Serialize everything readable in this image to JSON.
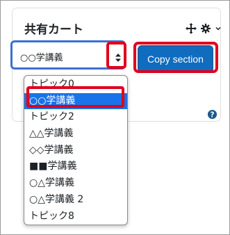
{
  "block": {
    "title": "共有カート"
  },
  "section_select": {
    "value": "○○学講義",
    "options": [
      "トピック0",
      "○○学講義",
      "トピック2",
      "△△学講義",
      "◇◇学講義",
      "■■学講義",
      "○△学講義",
      "○△学講義 2",
      "トピック8"
    ],
    "selected_index": 1
  },
  "copy_button": {
    "label": "Copy section"
  },
  "icons": {
    "move": "move-icon",
    "gear": "gear-icon",
    "chevron": "chevron-down-icon",
    "help": "help-icon",
    "select_arrows": "select-arrows-icon"
  },
  "colors": {
    "primary": "#0f6cbf",
    "highlight": "#e0001b",
    "selected_option": "#1a73e8",
    "focus_ring": "#3a70d0"
  }
}
